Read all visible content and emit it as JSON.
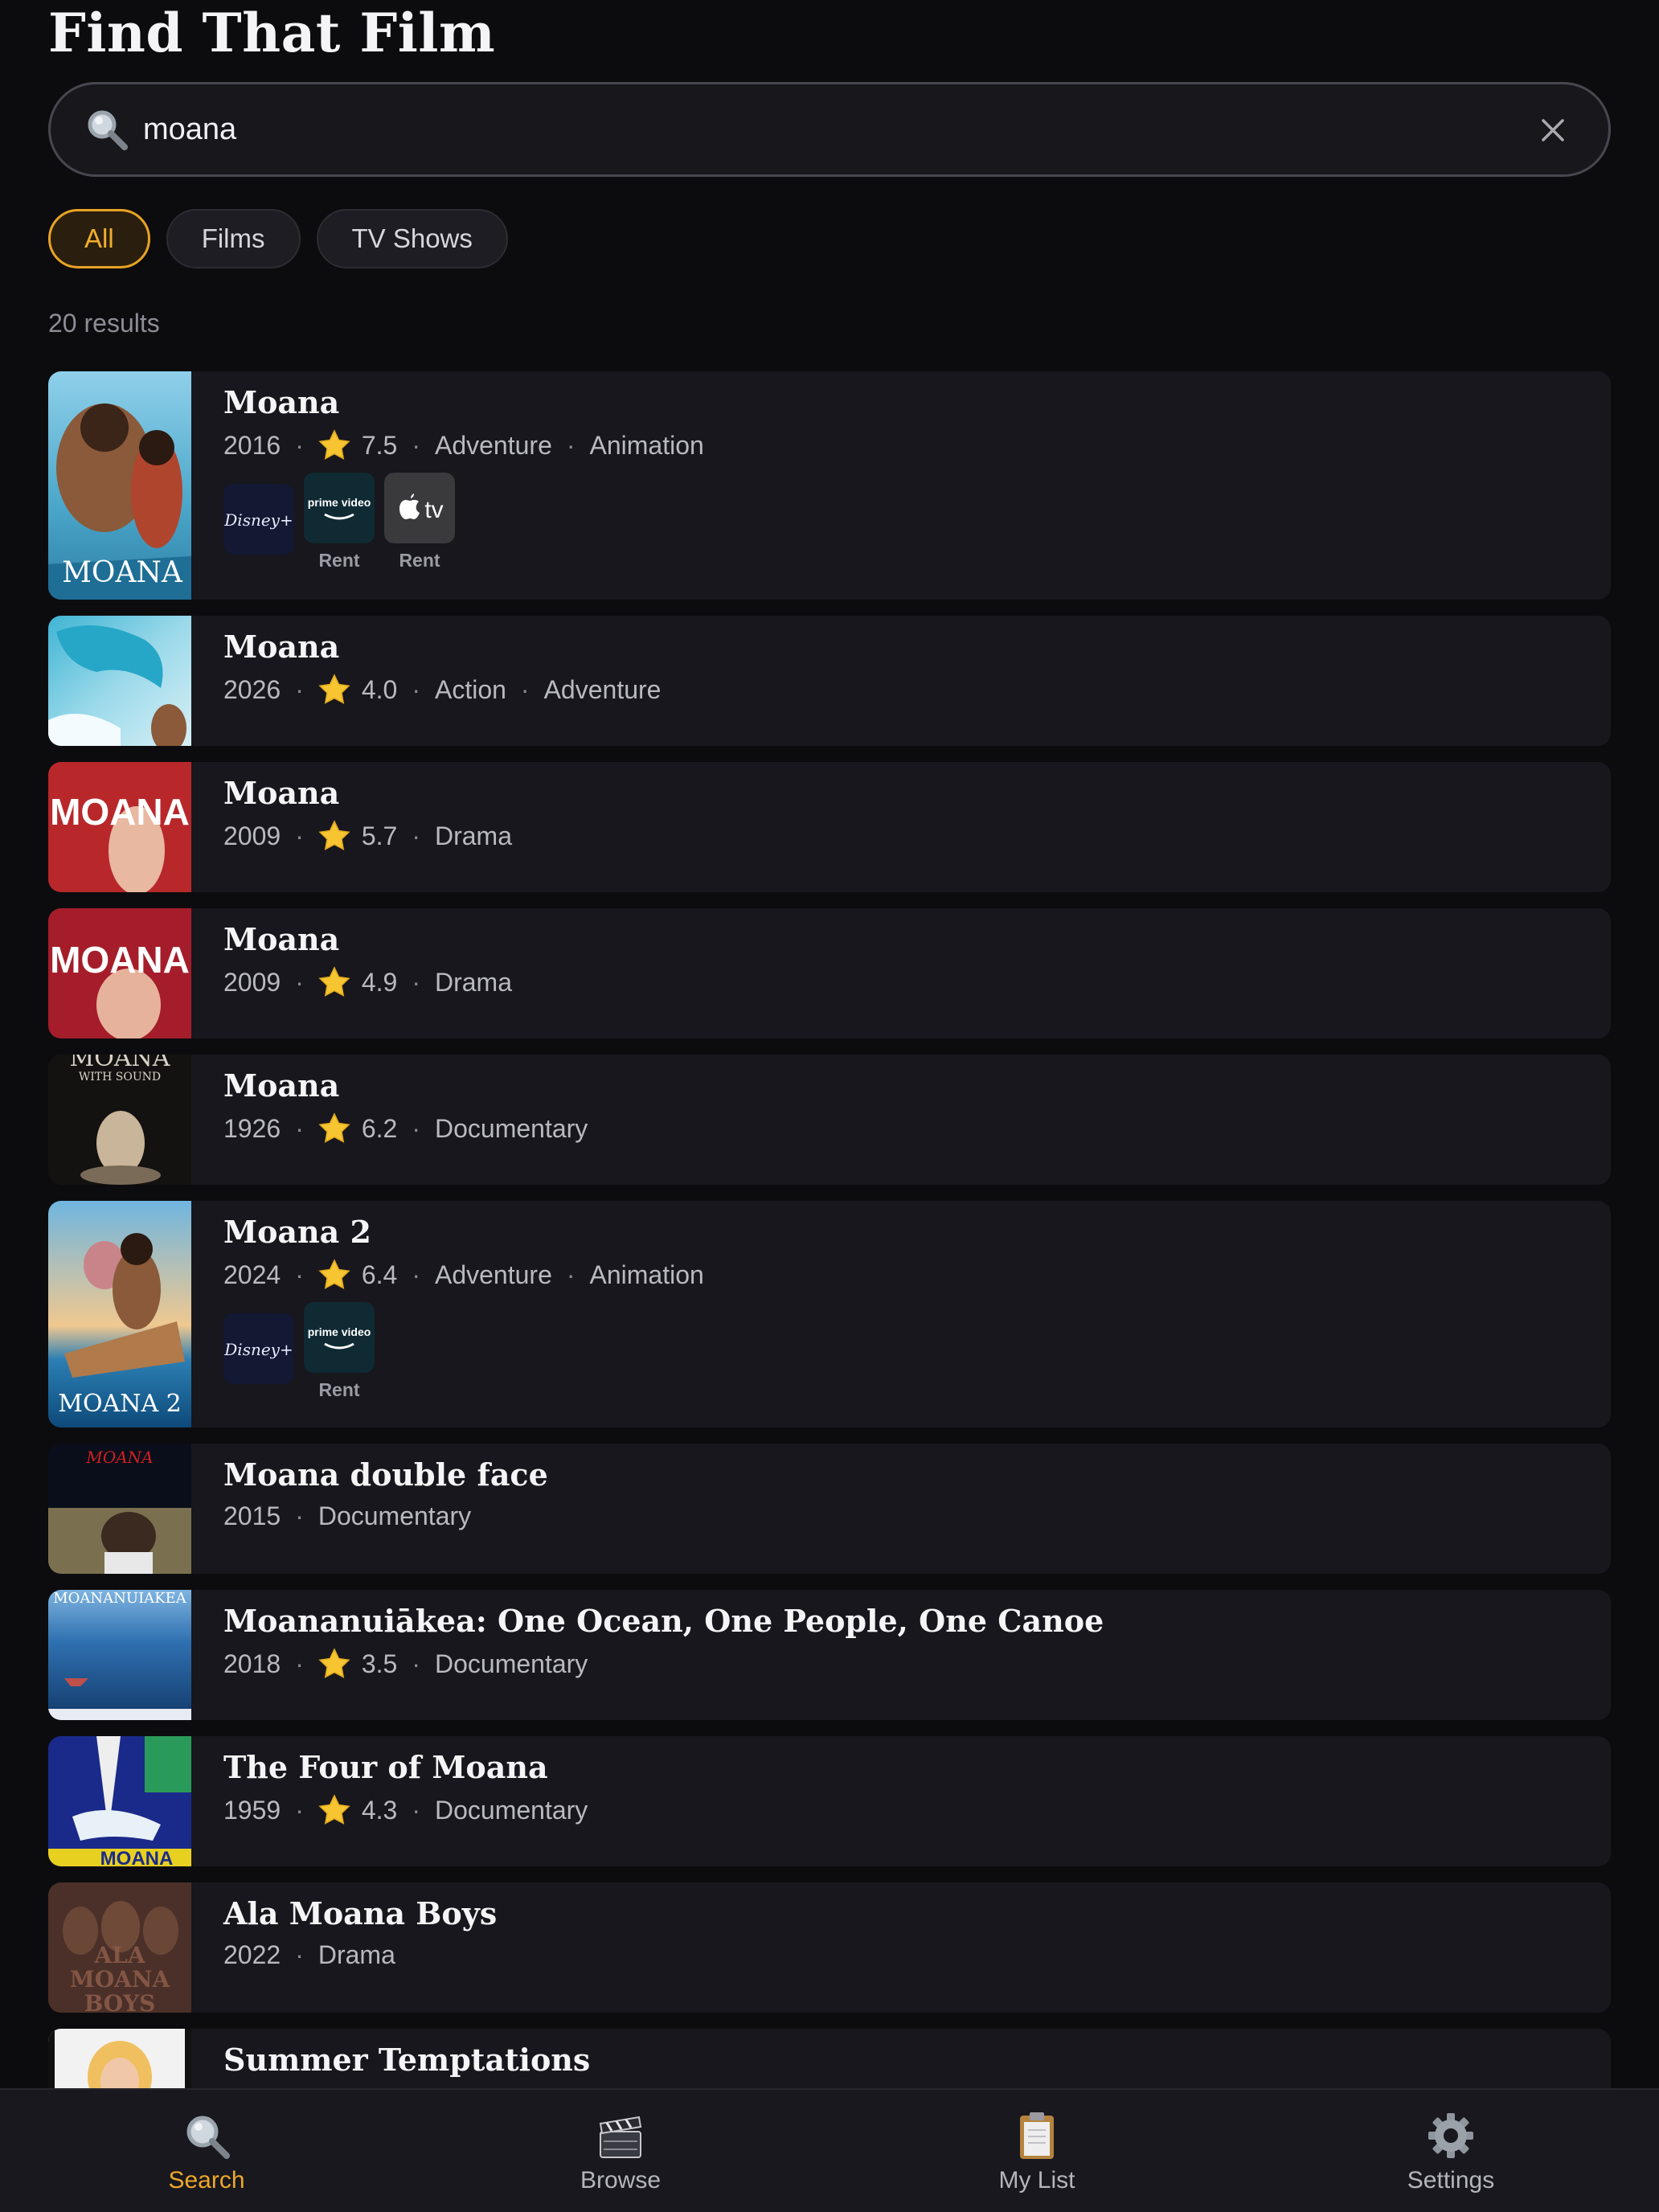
{
  "app": {
    "title": "Find That Film"
  },
  "search": {
    "value": "moana",
    "icon": "search-icon",
    "clear_icon": "close-icon"
  },
  "filters": [
    {
      "label": "All",
      "active": true
    },
    {
      "label": "Films",
      "active": false
    },
    {
      "label": "TV Shows",
      "active": false
    }
  ],
  "results_count": "20 results",
  "results": [
    {
      "title": "Moana",
      "year": "2016",
      "rating": "7.5",
      "genres": [
        "Adventure",
        "Animation"
      ],
      "providers": [
        {
          "name": "Disney+",
          "label": ""
        },
        {
          "name": "prime video",
          "label": "Rent"
        },
        {
          "name": "Apple TV",
          "label": "Rent"
        }
      ]
    },
    {
      "title": "Moana",
      "year": "2026",
      "rating": "4.0",
      "genres": [
        "Action",
        "Adventure"
      ]
    },
    {
      "title": "Moana",
      "year": "2009",
      "rating": "5.7",
      "genres": [
        "Drama"
      ]
    },
    {
      "title": "Moana",
      "year": "2009",
      "rating": "4.9",
      "genres": [
        "Drama"
      ]
    },
    {
      "title": "Moana",
      "year": "1926",
      "rating": "6.2",
      "genres": [
        "Documentary"
      ]
    },
    {
      "title": "Moana 2",
      "year": "2024",
      "rating": "6.4",
      "genres": [
        "Adventure",
        "Animation"
      ],
      "providers": [
        {
          "name": "Disney+",
          "label": ""
        },
        {
          "name": "prime video",
          "label": "Rent"
        }
      ]
    },
    {
      "title": "Moana double face",
      "year": "2015",
      "genres": [
        "Documentary"
      ]
    },
    {
      "title": "Moananuiākea: One Ocean, One People, One Canoe",
      "year": "2018",
      "rating": "3.5",
      "genres": [
        "Documentary"
      ]
    },
    {
      "title": "The Four of Moana",
      "year": "1959",
      "rating": "4.3",
      "genres": [
        "Documentary"
      ]
    },
    {
      "title": "Ala Moana Boys",
      "year": "2022",
      "genres": [
        "Drama"
      ]
    },
    {
      "title": "Summer Temptations"
    }
  ],
  "posters": {
    "p0": "MOANA",
    "p2": "MOANA",
    "p3": "MOANA",
    "p4a": "MOANA",
    "p4b": "WITH SOUND",
    "p5": "MOANA 2",
    "p6": "MOANA",
    "p7": "MOANANUIAKEA",
    "p8": "MOANA",
    "p9a": "ALA",
    "p9b": "MOANA",
    "p9c": "BOYS"
  },
  "provider_logos": {
    "prime": "prime video",
    "apple": "tv"
  },
  "tabs": [
    {
      "label": "Search",
      "icon": "search-icon",
      "active": true
    },
    {
      "label": "Browse",
      "icon": "clapperboard-icon",
      "active": false
    },
    {
      "label": "My List",
      "icon": "clipboard-icon",
      "active": false
    },
    {
      "label": "Settings",
      "icon": "gear-icon",
      "active": false
    }
  ],
  "colors": {
    "accent": "#eea72a",
    "background": "#0c0c0f",
    "row": "#17171d",
    "star": "#f7c531"
  }
}
